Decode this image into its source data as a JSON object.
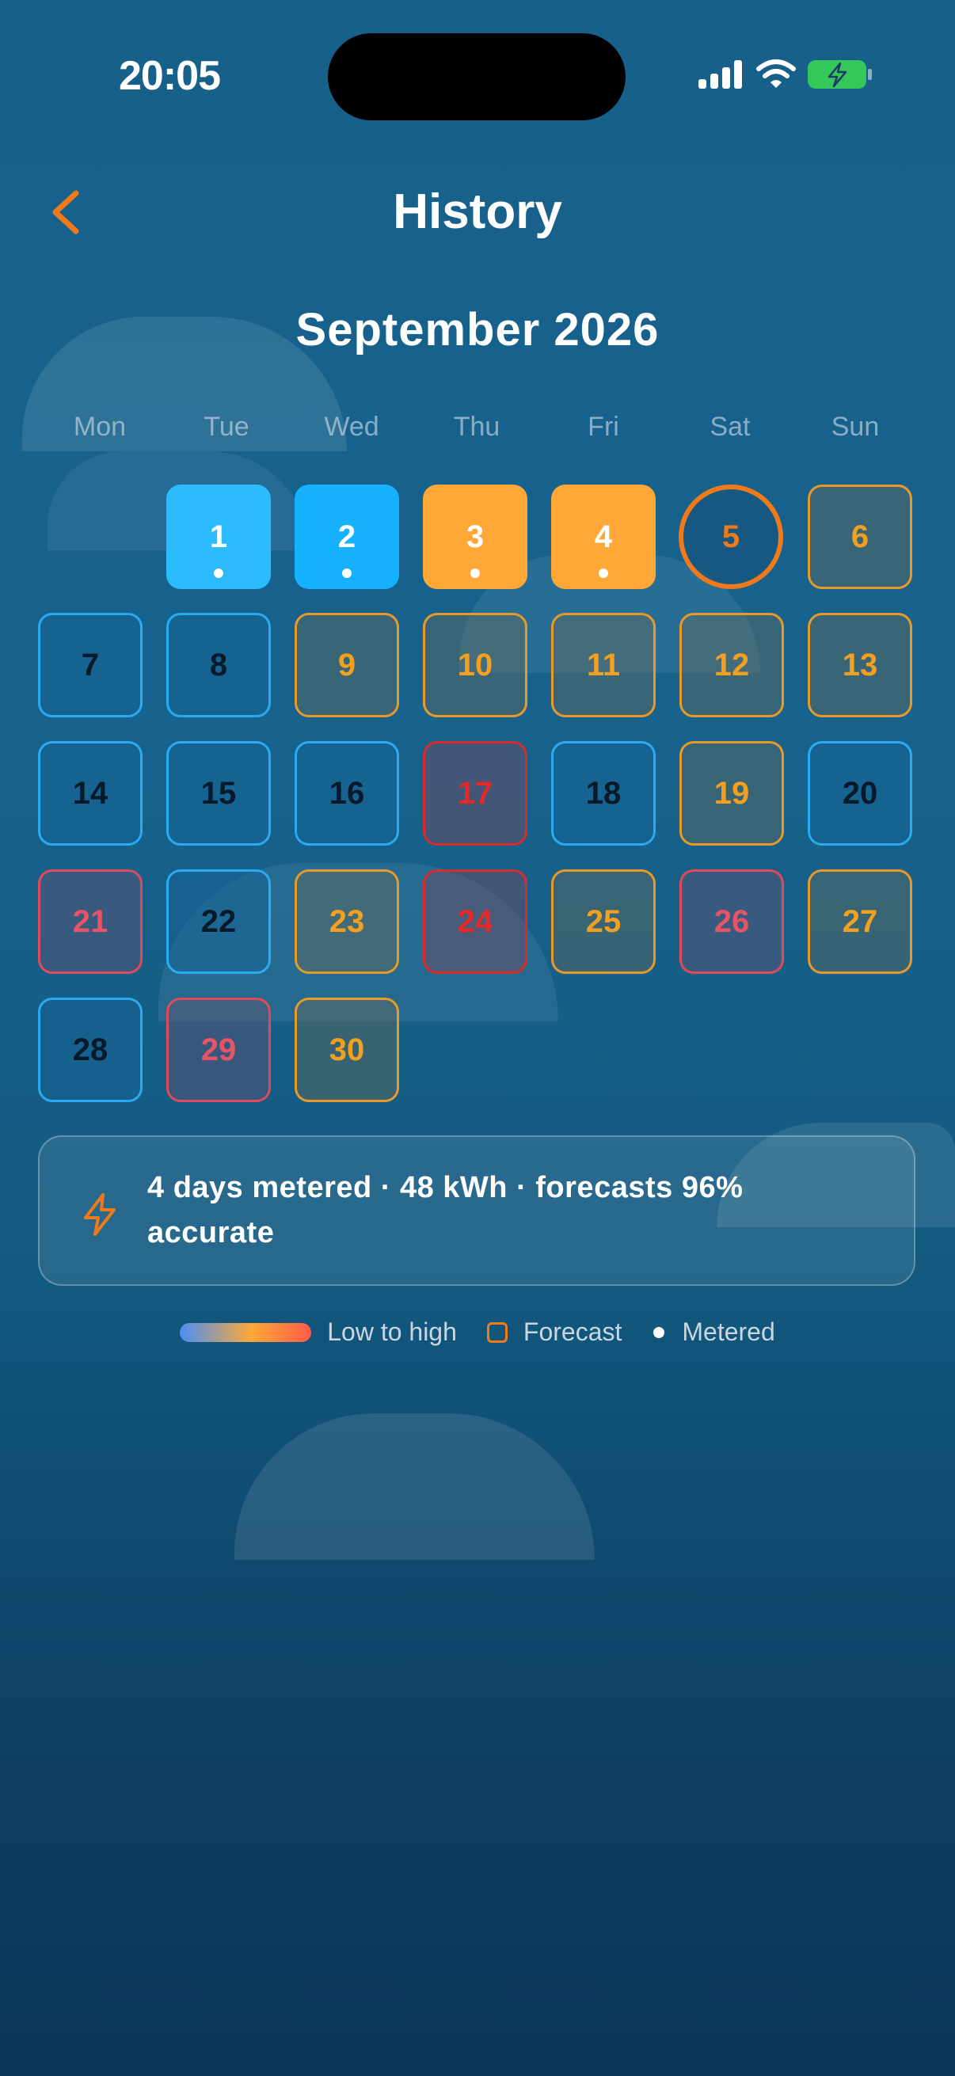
{
  "status_bar": {
    "time": "20:05"
  },
  "header": {
    "title": "History"
  },
  "calendar": {
    "month_label": "September 2026",
    "weekdays": [
      "Mon",
      "Tue",
      "Wed",
      "Thu",
      "Fri",
      "Sat",
      "Sun"
    ],
    "days": [
      {
        "day": "1",
        "style": "metered-low",
        "metered": true
      },
      {
        "day": "2",
        "style": "metered-low",
        "metered": true
      },
      {
        "day": "3",
        "style": "metered-mid",
        "metered": true
      },
      {
        "day": "4",
        "style": "metered-mid",
        "metered": true
      },
      {
        "day": "5",
        "style": "today",
        "metered": false
      },
      {
        "day": "6",
        "style": "forecast-mid",
        "metered": false
      },
      {
        "day": "7",
        "style": "forecast-low",
        "metered": false
      },
      {
        "day": "8",
        "style": "forecast-low",
        "metered": false
      },
      {
        "day": "9",
        "style": "forecast-mid",
        "metered": false
      },
      {
        "day": "10",
        "style": "forecast-mid",
        "metered": false
      },
      {
        "day": "11",
        "style": "forecast-mid",
        "metered": false
      },
      {
        "day": "12",
        "style": "forecast-mid",
        "metered": false
      },
      {
        "day": "13",
        "style": "forecast-mid",
        "metered": false
      },
      {
        "day": "14",
        "style": "forecast-low",
        "metered": false
      },
      {
        "day": "15",
        "style": "forecast-low",
        "metered": false
      },
      {
        "day": "16",
        "style": "forecast-low",
        "metered": false
      },
      {
        "day": "17",
        "style": "forecast-very-high",
        "metered": false
      },
      {
        "day": "18",
        "style": "forecast-low",
        "metered": false
      },
      {
        "day": "19",
        "style": "forecast-mid",
        "metered": false
      },
      {
        "day": "20",
        "style": "forecast-low",
        "metered": false
      },
      {
        "day": "21",
        "style": "forecast-high",
        "metered": false
      },
      {
        "day": "22",
        "style": "forecast-low",
        "metered": false
      },
      {
        "day": "23",
        "style": "forecast-mid",
        "metered": false
      },
      {
        "day": "24",
        "style": "forecast-very-high",
        "metered": false
      },
      {
        "day": "25",
        "style": "forecast-mid",
        "metered": false
      },
      {
        "day": "26",
        "style": "forecast-high",
        "metered": false
      },
      {
        "day": "27",
        "style": "forecast-mid",
        "metered": false
      },
      {
        "day": "28",
        "style": "forecast-low",
        "metered": false
      },
      {
        "day": "29",
        "style": "forecast-high",
        "metered": false
      },
      {
        "day": "30",
        "style": "forecast-mid",
        "metered": false
      }
    ]
  },
  "summary": {
    "text": "4 days metered · 48 kWh · forecasts 96% accurate"
  },
  "legend": {
    "scale_label": "Low to high",
    "forecast_label": "Forecast",
    "metered_label": "Metered"
  },
  "colors": {
    "accent": "#f07a1a",
    "metered_low": "#16b2ff",
    "metered_mid": "#ffa838",
    "low": "#2aaaf0",
    "mid": "#e79a2a",
    "high": "#e04a5a",
    "very_high": "#d82c2c"
  }
}
